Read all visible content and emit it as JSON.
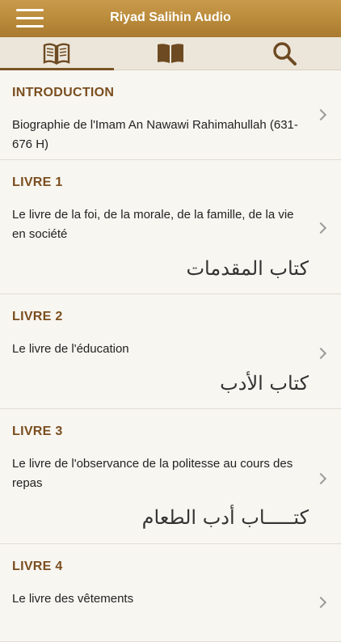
{
  "app": {
    "title": "Riyad Salihin Audio"
  },
  "tabs": [
    {
      "icon": "open-book-icon",
      "active": true
    },
    {
      "icon": "book-icon",
      "active": false
    },
    {
      "icon": "search-icon",
      "active": false
    }
  ],
  "items": [
    {
      "heading": "INTRODUCTION",
      "desc": "Biographie de l'Imam An Nawawi Rahimahullah (631-676 H)",
      "arabic": ""
    },
    {
      "heading": "LIVRE 1",
      "desc": "Le livre de la foi, de la morale, de la famille, de la vie en société",
      "arabic": "كتاب المقدمات"
    },
    {
      "heading": "LIVRE 2",
      "desc": "Le livre de l'éducation",
      "arabic": "كتاب الأدب"
    },
    {
      "heading": "LIVRE 3",
      "desc": "Le livre de l'observance de la politesse au cours des repas",
      "arabic": "كتـــــاب أدب الطعام"
    },
    {
      "heading": "LIVRE 4",
      "desc": "Le livre des vêtements",
      "arabic": ""
    }
  ]
}
